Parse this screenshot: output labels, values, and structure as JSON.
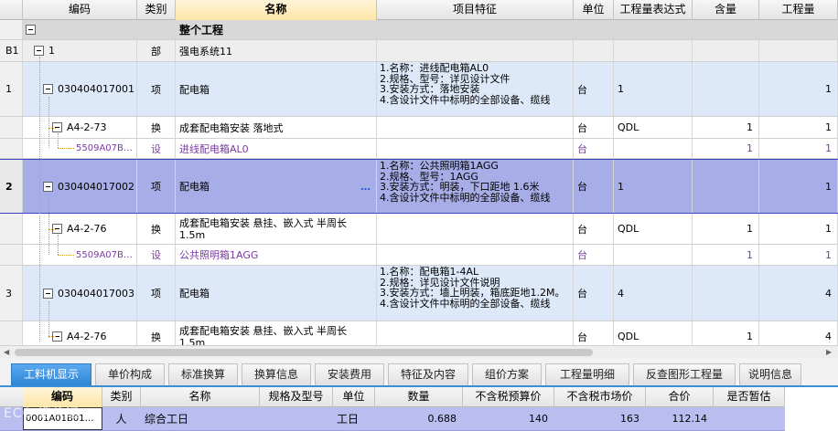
{
  "columns": {
    "code": "编码",
    "type": "类别",
    "name": "名称",
    "feature": "项目特征",
    "unit": "单位",
    "expr": "工程量表达式",
    "content": "含量",
    "qty": "工程量"
  },
  "rows": {
    "r0": {
      "name": "整个工程"
    },
    "r1": {
      "rownum": "B1",
      "code": "1",
      "type": "部",
      "name": "强电系统11"
    },
    "r2": {
      "rownum": "1",
      "code": "030404017001",
      "type": "项",
      "name": "配电箱",
      "feature": "1.名称：进线配电箱AL0\n2.规格、型号：详见设计文件\n3.安装方式：落地安装\n4.含设计文件中标明的全部设备、缆线",
      "unit": "台",
      "expr": "1",
      "qty": "1"
    },
    "r3": {
      "code": "A4-2-73",
      "type": "换",
      "name": "成套配电箱安装 落地式",
      "unit": "台",
      "expr": "QDL",
      "content": "1",
      "qty": "1"
    },
    "r4": {
      "code": "5509A07B…",
      "type": "设",
      "name": "进线配电箱AL0",
      "unit": "台",
      "content": "1",
      "qty": "1"
    },
    "r5": {
      "rownum": "2",
      "code": "030404017002",
      "type": "项",
      "name": "配电箱",
      "more": "…",
      "feature": "1.名称：公共照明箱1AGG\n2.规格、型号：1AGG\n3.安装方式：明装，下口距地 1.6米\n4.含设计文件中标明的全部设备、缆线",
      "unit": "台",
      "expr": "1",
      "qty": "1"
    },
    "r6": {
      "code": "A4-2-76",
      "type": "换",
      "name": "成套配电箱安装 悬挂、嵌入式 半周长\n1.5m",
      "unit": "台",
      "expr": "QDL",
      "content": "1",
      "qty": "1"
    },
    "r7": {
      "code": "5509A07B…",
      "type": "设",
      "name": "公共照明箱1AGG",
      "unit": "台",
      "content": "1",
      "qty": "1"
    },
    "r8": {
      "rownum": "3",
      "code": "030404017003",
      "type": "项",
      "name": "配电箱",
      "feature": "1.名称：配电箱1-4AL\n2.规格：详见设计文件说明\n3.安装方式：墙上明装，箱底距地1.2M。\n4.含设计文件中标明的全部设备、缆线",
      "unit": "台",
      "expr": "4",
      "qty": "4"
    },
    "r9": {
      "code": "A4-2-76",
      "type": "换",
      "name": "成套配电箱安装 悬挂、嵌入式 半周长\n1.5m",
      "unit": "台",
      "expr": "QDL",
      "content": "1",
      "qty": "4"
    }
  },
  "tabs": [
    "工料机显示",
    "单价构成",
    "标准换算",
    "换算信息",
    "安装费用",
    "特征及内容",
    "组价方案",
    "工程量明细",
    "反查图形工程量",
    "说明信息"
  ],
  "lower": {
    "columns": [
      "编码",
      "类别",
      "名称",
      "规格及型号",
      "单位",
      "数量",
      "不含税预算价",
      "不含税市场价",
      "合价",
      "是否暂估"
    ],
    "row": {
      "code": "0001A01B01…",
      "type": "人",
      "name": "综合工日",
      "spec": "",
      "unit": "工日",
      "qty": "0.688",
      "budget": "140",
      "market": "163",
      "total": "112.14",
      "est": ""
    }
  },
  "watermark": "ECO 造价通"
}
